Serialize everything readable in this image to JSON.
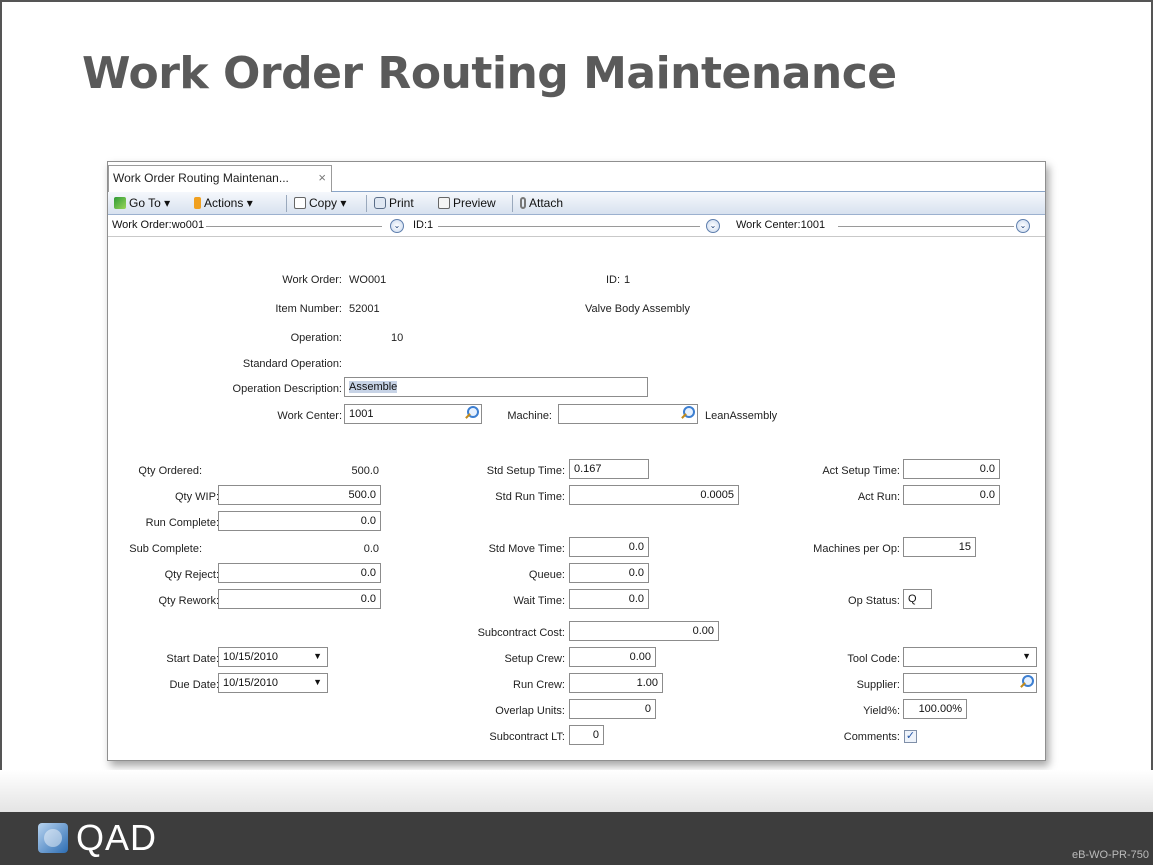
{
  "slide": {
    "title": "Work Order Routing Maintenance",
    "logo_text": "QAD",
    "doc_code": "eB-WO-PR-750"
  },
  "window": {
    "tab_title": "Work Order Routing Maintenan...",
    "tab_close": "×",
    "toolbar": {
      "goto": "Go To",
      "actions": "Actions",
      "copy": "Copy",
      "print": "Print",
      "preview": "Preview",
      "attach": "Attach",
      "menu_arrow": "▾"
    },
    "selector": {
      "work_order": "Work Order:wo001",
      "id": "ID:1",
      "work_center": "Work Center:1001",
      "expand_glyph": "⌄"
    }
  },
  "header": {
    "work_order_label": "Work Order:",
    "work_order_value": "WO001",
    "id_label": "ID:",
    "id_value": "1",
    "item_number_label": "Item Number:",
    "item_number_value": "52001",
    "item_description": "Valve Body Assembly",
    "operation_label": "Operation:",
    "operation_value": "10",
    "standard_operation_label": "Standard Operation:",
    "operation_description_label": "Operation Description:",
    "operation_description_value": "Assemble",
    "work_center_label": "Work Center:",
    "work_center_value": "1001",
    "machine_label": "Machine:",
    "machine_value": "",
    "work_center_description": "LeanAssembly"
  },
  "quantities": {
    "qty_ordered_label": "Qty Ordered:",
    "qty_ordered_value": "500.0",
    "qty_wip_label": "Qty WIP:",
    "qty_wip_value": "500.0",
    "run_complete_label": "Run Complete:",
    "run_complete_value": "0.0",
    "sub_complete_label": "Sub Complete:",
    "sub_complete_value": "0.0",
    "qty_reject_label": "Qty Reject:",
    "qty_reject_value": "0.0",
    "qty_rework_label": "Qty Rework:",
    "qty_rework_value": "0.0",
    "start_date_label": "Start Date:",
    "start_date_value": "10/15/2010",
    "due_date_label": "Due Date:",
    "due_date_value": "10/15/2010",
    "dropdown_glyph": "▼"
  },
  "times": {
    "std_setup_label": "Std Setup Time:",
    "std_setup_value": "0.167",
    "std_run_label": "Std Run Time:",
    "std_run_value": "0.0005",
    "std_move_label": "Std Move Time:",
    "std_move_value": "0.0",
    "queue_label": "Queue:",
    "queue_value": "0.0",
    "wait_label": "Wait Time:",
    "wait_value": "0.0",
    "subcontract_cost_label": "Subcontract Cost:",
    "subcontract_cost_value": "0.00",
    "setup_crew_label": "Setup Crew:",
    "setup_crew_value": "0.00",
    "run_crew_label": "Run Crew:",
    "run_crew_value": "1.00",
    "overlap_units_label": "Overlap Units:",
    "overlap_units_value": "0",
    "subcontract_lt_label": "Subcontract LT:",
    "subcontract_lt_value": "0"
  },
  "actuals": {
    "act_setup_label": "Act Setup Time:",
    "act_setup_value": "0.0",
    "act_run_label": "Act Run:",
    "act_run_value": "0.0",
    "machines_per_op_label": "Machines per Op:",
    "machines_per_op_value": "15",
    "op_status_label": "Op Status:",
    "op_status_value": "Q",
    "tool_code_label": "Tool Code:",
    "tool_code_value": "",
    "supplier_label": "Supplier:",
    "supplier_value": "",
    "yield_label": "Yield%:",
    "yield_value": "100.00%",
    "comments_label": "Comments:",
    "comments_check": "✓"
  },
  "colors": {
    "title": "#5a5a5a",
    "footer": "#3d3d3d",
    "toolbar_accent": "#d8e2ef",
    "selection": "#c7d3e6"
  }
}
